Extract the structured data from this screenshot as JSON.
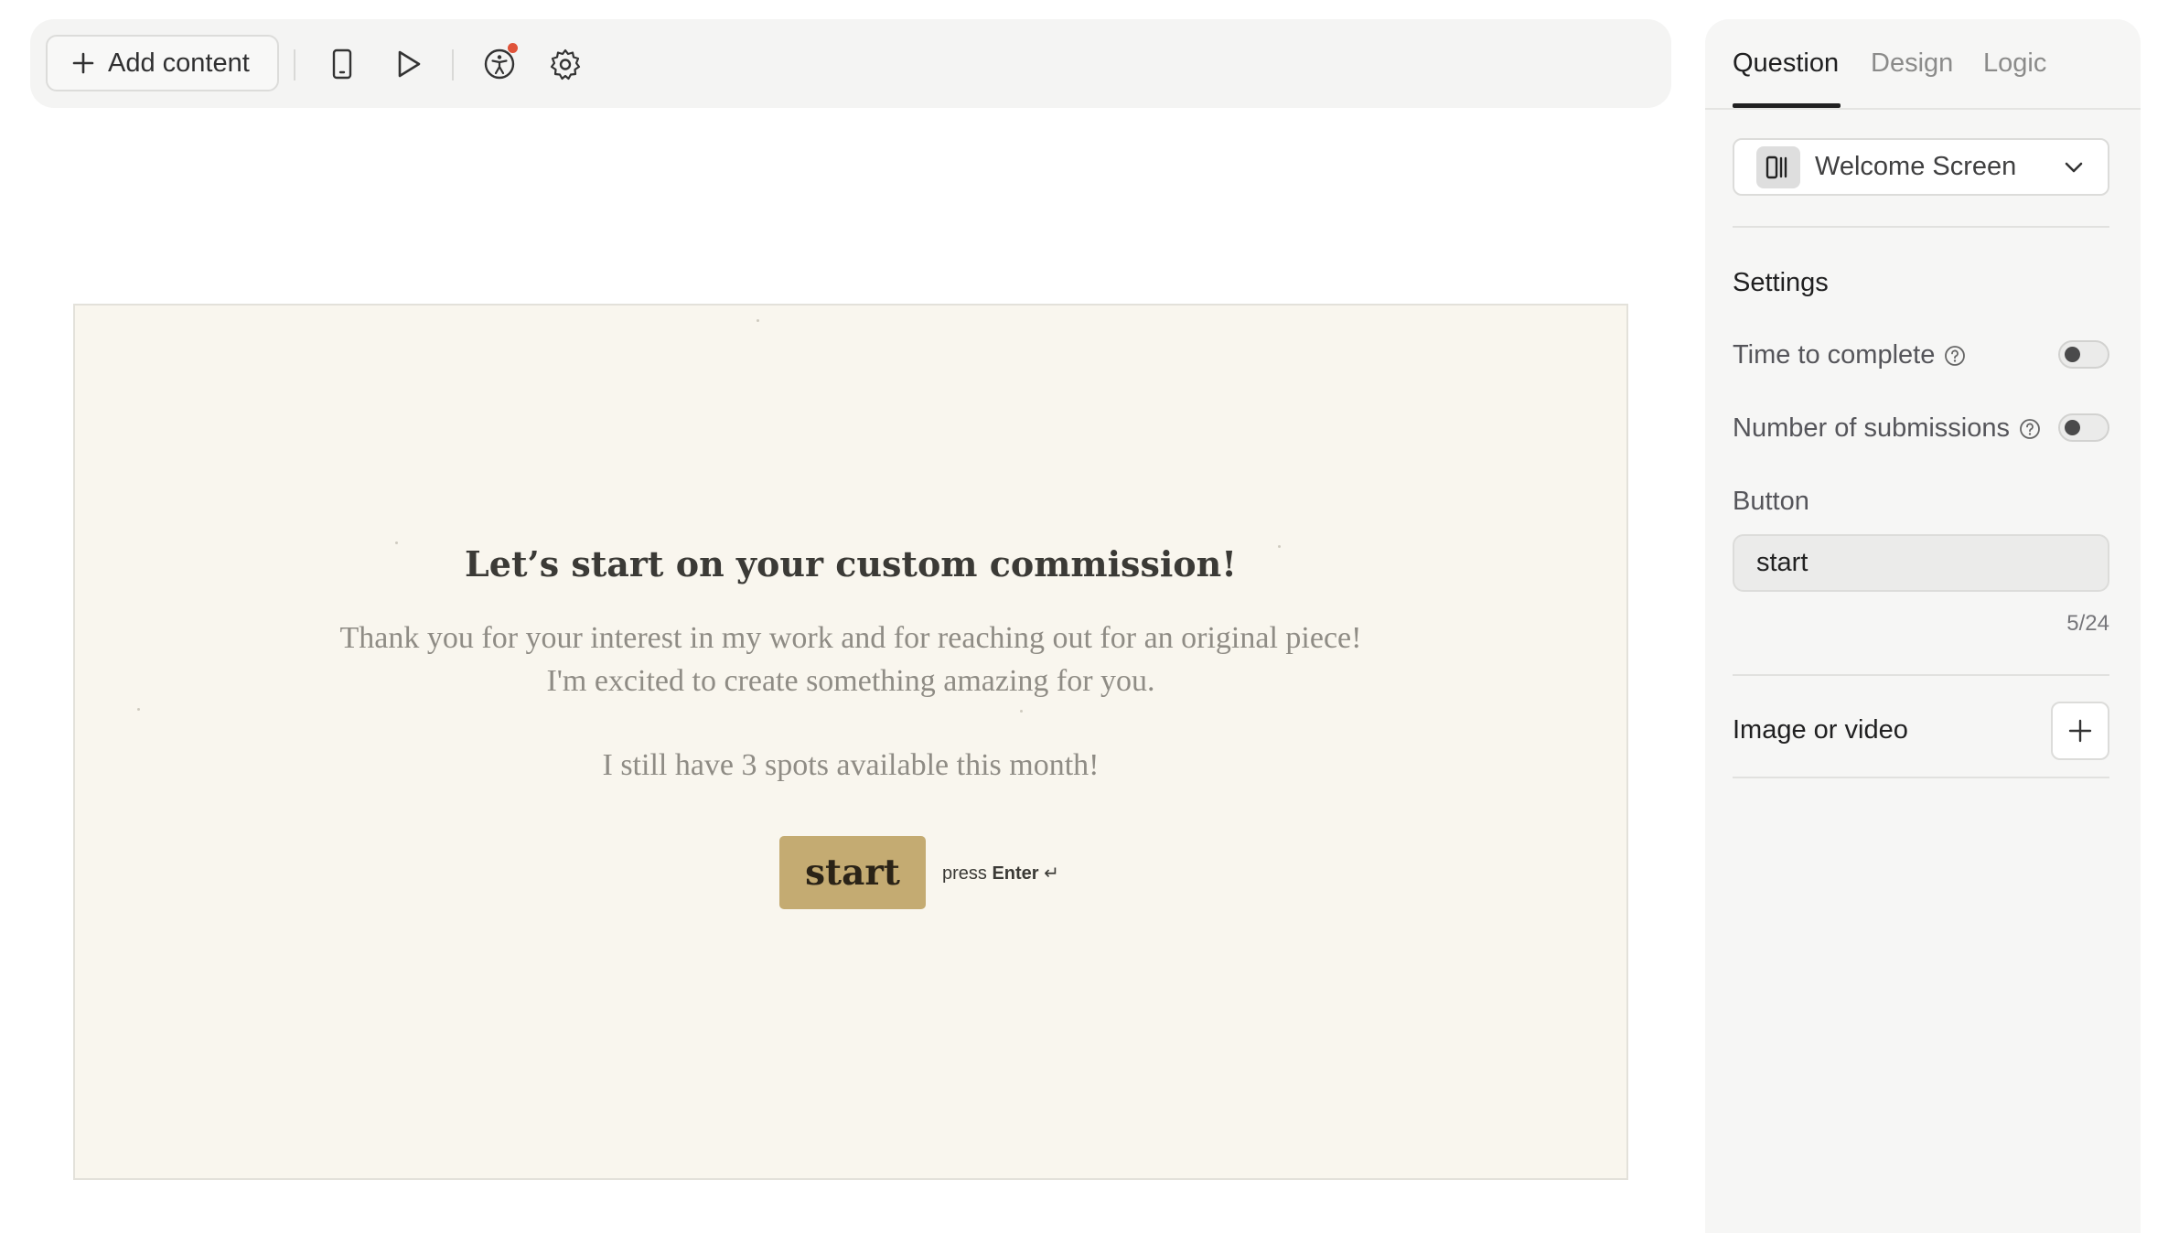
{
  "toolbar": {
    "add_content_label": "Add content",
    "icons": [
      "plus-icon",
      "mobile-preview-icon",
      "play-icon",
      "accessibility-icon",
      "gear-icon"
    ],
    "notification_color": "#e0533a"
  },
  "preview": {
    "title": "Let’s start on your custom commission!",
    "description_line1": "Thank you for your interest in my work and for reaching out for an original piece!",
    "description_line2": "I'm excited to create something amazing for you.",
    "description_line3": "I still have 3 spots available this month!",
    "button_label": "start",
    "hint_prefix": "press",
    "hint_key": "Enter",
    "hint_symbol": "↵",
    "button_color": "#c4ab72",
    "background_color": "#f9f6ee"
  },
  "panel": {
    "tabs": [
      {
        "label": "Question",
        "active": true
      },
      {
        "label": "Design",
        "active": false
      },
      {
        "label": "Logic",
        "active": false
      }
    ],
    "screen_type": {
      "label": "Welcome Screen",
      "icon": "welcome-screen-icon"
    },
    "settings_title": "Settings",
    "time_to_complete": {
      "label": "Time to complete",
      "enabled": false
    },
    "number_of_submissions": {
      "label": "Number of submissions",
      "enabled": false
    },
    "button_section": {
      "title": "Button",
      "value": "start",
      "counter": "5/24"
    },
    "media_section": {
      "title": "Image or video"
    }
  }
}
